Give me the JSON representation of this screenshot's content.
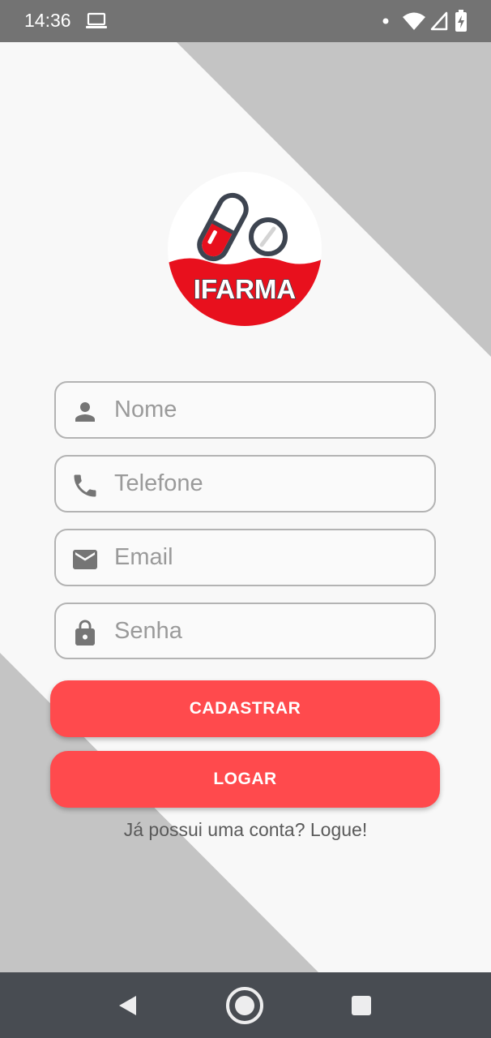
{
  "status_bar": {
    "time": "14:36",
    "icons": [
      "laptop-icon",
      "dot-icon",
      "wifi-icon",
      "signal-icon",
      "battery-charging-icon"
    ]
  },
  "logo": {
    "text": "IFARMA",
    "icon": "pills-icon"
  },
  "form": {
    "fields": [
      {
        "placeholder": "Nome",
        "icon": "person-icon"
      },
      {
        "placeholder": "Telefone",
        "icon": "phone-icon"
      },
      {
        "placeholder": "Email",
        "icon": "mail-icon"
      },
      {
        "placeholder": "Senha",
        "icon": "lock-icon"
      }
    ],
    "register_label": "CADASTRAR",
    "login_label": "LOGAR",
    "login_link": "Já possui uma conta? Logue!"
  },
  "nav_bar": {
    "icons": [
      "back-icon",
      "home-icon",
      "recents-icon"
    ]
  },
  "colors": {
    "accent": "#ff4a4d",
    "background": "#f8f8f8",
    "background_shape": "#c4c4c4",
    "status_bar": "#737373",
    "nav_bar": "#484c52",
    "field_border": "#b3b3b3"
  }
}
